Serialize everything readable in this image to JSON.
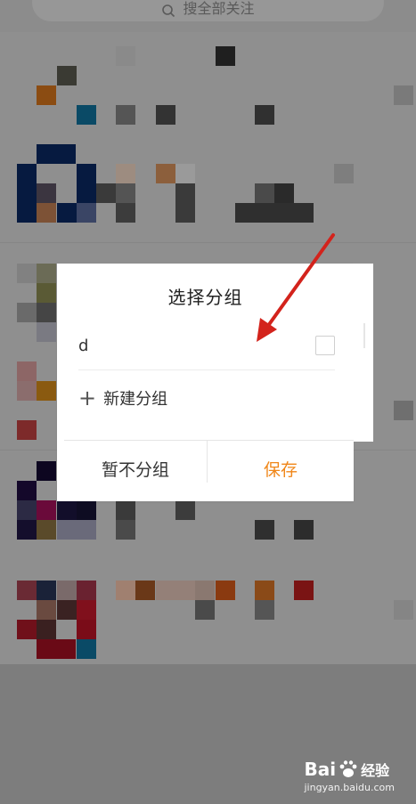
{
  "search": {
    "placeholder": "搜全部关注"
  },
  "dialog": {
    "title": "选择分组",
    "groups": [
      {
        "name": "d",
        "checked": false
      }
    ],
    "new_group_label": "新建分组",
    "buttons": {
      "no_group": "暂不分组",
      "save": "保存"
    },
    "accent_color": "#f0871a"
  },
  "annotation": {
    "arrow_color": "#d3231c"
  },
  "watermark": {
    "brand": "Bai",
    "brand_suffix": "经验",
    "url": "jingyan.baidu.com"
  }
}
